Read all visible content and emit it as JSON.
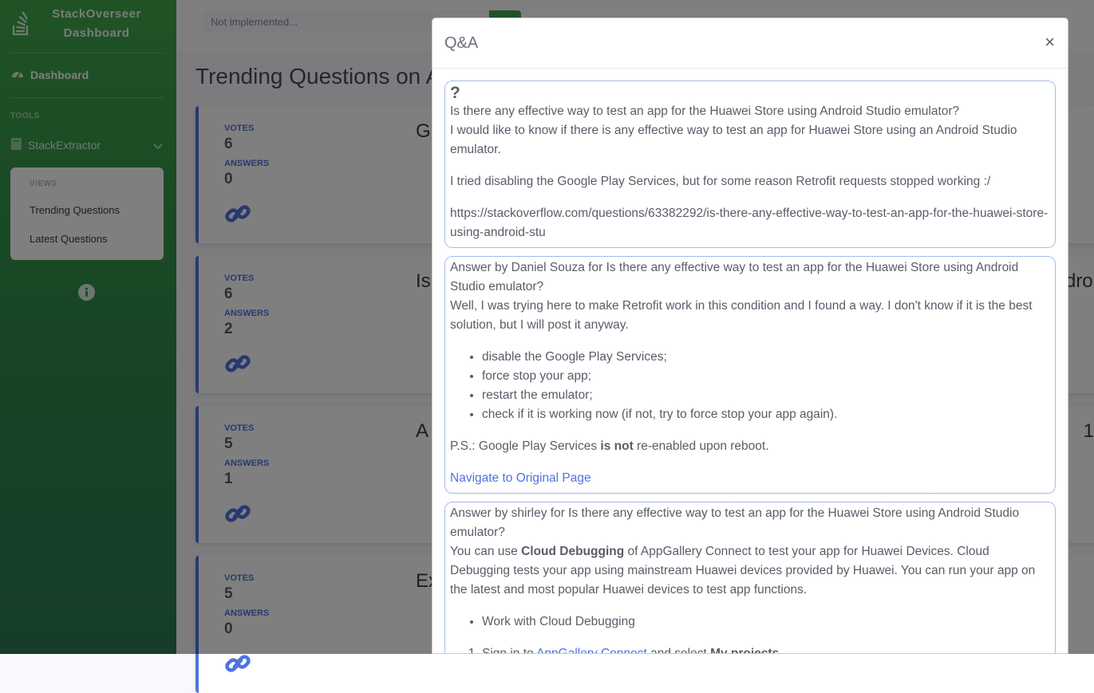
{
  "sidebar": {
    "brand_line1": "StackOverseer",
    "brand_line2": "Dashboard",
    "dashboard_label": "Dashboard",
    "tools_heading": "TOOLS",
    "tool_label": "StackExtractor",
    "views_heading": "VIEWS",
    "views": [
      "Trending Questions",
      "Latest Questions"
    ]
  },
  "topbar": {
    "search_placeholder": "Not implemented..."
  },
  "main": {
    "title": "Trending Questions on A",
    "cards": [
      {
        "votes_label": "VOTES",
        "votes": "6",
        "answers_label": "ANSWERS",
        "answers": "0",
        "title_fragment": "G",
        "edge_fragment": ""
      },
      {
        "votes_label": "VOTES",
        "votes": "6",
        "answers_label": "ANSWERS",
        "answers": "2",
        "title_fragment": "Is",
        "edge_fragment": "droi"
      },
      {
        "votes_label": "VOTES",
        "votes": "5",
        "answers_label": "ANSWERS",
        "answers": "1",
        "title_fragment": "A",
        "edge_fragment": "1"
      },
      {
        "votes_label": "VOTES",
        "votes": "5",
        "answers_label": "ANSWERS",
        "answers": "0",
        "title_fragment": "Ex",
        "edge_fragment": ""
      }
    ]
  },
  "modal": {
    "title": "Q&A",
    "close": "×",
    "question": {
      "mark": "?",
      "title": "Is there any effective way to test an app for the Huawei Store using Android Studio emulator?",
      "body1": "I would like to know if there is any effective way to test an app for Huawei Store using an Android Studio emulator.",
      "body2": "I tried disabling the Google Play Services, but for some reason Retrofit requests stopped working :/",
      "url": "https://stackoverflow.com/questions/63382292/is-there-any-effective-way-to-test-an-app-for-the-huawei-store-using-android-stu"
    },
    "answer1": {
      "heading": "Answer by Daniel Souza for Is there any effective way to test an app for the Huawei Store using Android Studio emulator?",
      "intro": "Well, I was trying here to make Retrofit work in this condition and I found a way. I don't know if it is the best solution, but I will post it anyway.",
      "steps": [
        "disable the Google Play Services;",
        "force stop your app;",
        "restart the emulator;",
        "check if it is working now (if not, try to force stop your app again)."
      ],
      "ps_pre": "P.S.: Google Play Services ",
      "ps_bold": "is not",
      "ps_post": " re-enabled upon reboot.",
      "link": "Navigate to Original Page"
    },
    "answer2": {
      "heading": "Answer by shirley for Is there any effective way to test an app for the Huawei Store using Android Studio emulator?",
      "intro_pre": "You can use ",
      "intro_bold": "Cloud Debugging",
      "intro_post": " of AppGallery Connect to test your app for Huawei Devices. Cloud Debugging tests your app using mainstream Huawei devices provided by Huawei. You can run your app on the latest and most popular Huawei devices to test app functions.",
      "bullet": "Work with Cloud Debugging",
      "step1_pre": "Sign in to ",
      "step1_link": "AppGallery Connect",
      "step1_mid": " and select ",
      "step1_bold": "My projects",
      "step1_post": "."
    }
  },
  "colors": {
    "sidebar_green": "#3fa64a",
    "primary_blue": "#4e73df"
  }
}
